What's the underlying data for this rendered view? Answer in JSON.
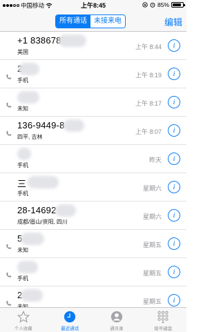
{
  "status_bar": {
    "carrier": "中国移动",
    "time": "上午8:45",
    "battery": "85%",
    "battery_level": 0.85
  },
  "nav": {
    "segments": [
      "所有通话",
      "未接来电"
    ],
    "active_segment": 0,
    "edit_label": "编辑"
  },
  "calls": [
    {
      "name": "+1 8386787",
      "sub": "美国",
      "time": "上午 8:44",
      "missed": false,
      "outgoing": false
    },
    {
      "name": "2",
      "sub": "手机",
      "time": "上午 8:19",
      "missed": false,
      "outgoing": true
    },
    {
      "name": "",
      "sub": "未知",
      "time": "上午 8:17",
      "missed": false,
      "outgoing": true
    },
    {
      "name": "136-9449-8",
      "sub": "四平, 吉林",
      "time": "上午 8:07",
      "missed": false,
      "outgoing": true
    },
    {
      "name": "",
      "sub": "手机",
      "time": "昨天",
      "missed": true,
      "outgoing": false
    },
    {
      "name": "三",
      "sub": "手机",
      "time": "星期六",
      "missed": false,
      "outgoing": false
    },
    {
      "name": "28-14692",
      "sub": "成都/眉山/资阳, 四川",
      "time": "星期六",
      "missed": false,
      "outgoing": false
    },
    {
      "name": "5",
      "sub": "未知",
      "time": "星期五",
      "missed": false,
      "outgoing": true
    },
    {
      "name": "",
      "sub": "手机",
      "time": "星期五",
      "missed": false,
      "outgoing": true
    },
    {
      "name": "2",
      "sub": "未知",
      "time": "星期五",
      "missed": false,
      "outgoing": true
    }
  ],
  "tabs": [
    {
      "label": "个人收藏",
      "icon": "star-icon"
    },
    {
      "label": "最近通话",
      "icon": "clock-icon"
    },
    {
      "label": "通讯录",
      "icon": "contacts-icon"
    },
    {
      "label": "拨号键盘",
      "icon": "keypad-icon"
    }
  ],
  "active_tab": 1,
  "colors": {
    "accent": "#0a7cf5",
    "missed": "#ff3b30",
    "secondary": "#8e8e93"
  }
}
